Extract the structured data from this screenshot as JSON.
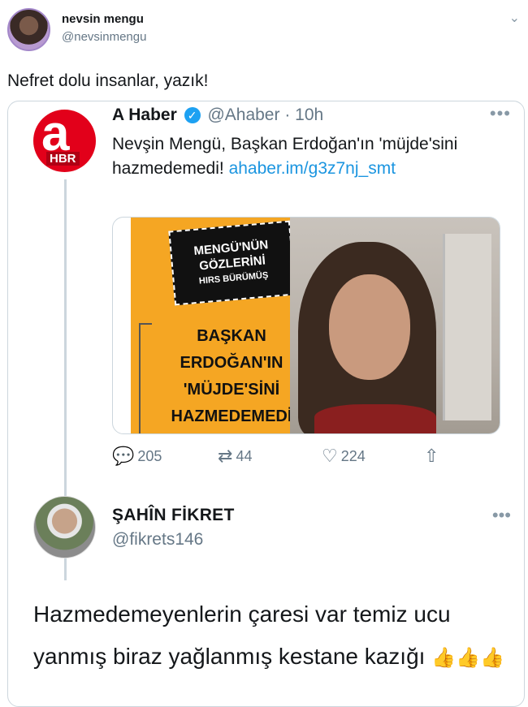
{
  "header": {
    "name": "nevsin mengu",
    "handle": "@nevsinmengu",
    "caret": "⌄"
  },
  "tweet": {
    "text": "Nefret dolu insanlar, yazık!"
  },
  "quoted": {
    "name": "A Haber",
    "handle": "@Ahaber",
    "time": "· 10h",
    "body": "Nevşin Mengü, Başkan Erdoğan'ın 'müjde'sini hazmedemedi! ",
    "link": "ahaber.im/g3z7nj_smt",
    "more": "•••",
    "avatar_label": "a",
    "avatar_badge": "HBR",
    "media": {
      "box_line1": "MENGÜ'NÜN",
      "box_line2": "GÖZLERİNİ",
      "box_line3": "HIRS BÜRÜMÜŞ",
      "headline": "BAŞKAN ERDOĞAN'IN 'MÜJDE'SİNİ HAZMEDEMEDİ"
    },
    "actions": {
      "reply_count": "205",
      "retweet_count": "44",
      "like_count": "224"
    }
  },
  "reply": {
    "name": "ŞAHÎN FİKRET",
    "handle": "@fikrets146",
    "more": "•••",
    "text": "Hazmedemeyenlerin çaresi var temiz ucu yanmış biraz yağlanmış kestane kazığı",
    "emoji": "👍👍👍"
  },
  "colors": {
    "accent": "#1da1f2",
    "link": "#1b95e0",
    "muted": "#657786",
    "brand_red": "#e2001a",
    "poster_orange": "#f5a623"
  }
}
